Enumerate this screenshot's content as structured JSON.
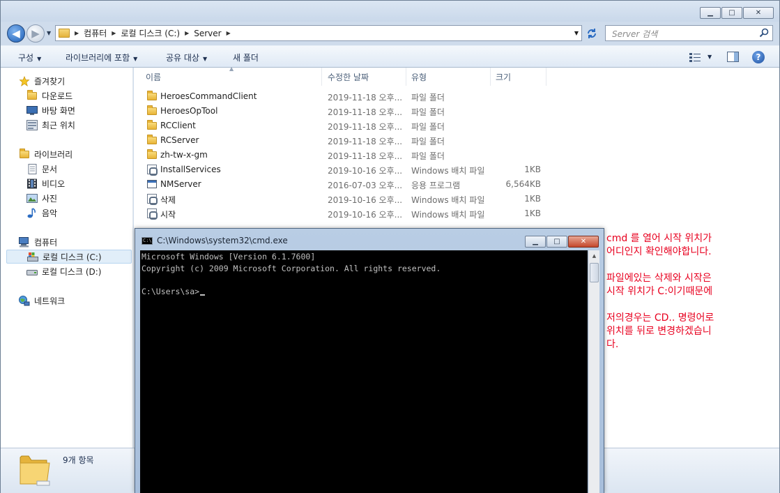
{
  "explorer": {
    "window_buttons": {
      "minimize": "▁",
      "maximize": "□",
      "close": "✕"
    },
    "nav": {
      "back": "◀",
      "forward": "▶"
    },
    "breadcrumb": [
      "컴퓨터",
      "로컬 디스크 (C:)",
      "Server"
    ],
    "search_placeholder": "Server 검색",
    "toolbar": {
      "organize": "구성",
      "include_library": "라이브러리에 포함",
      "share": "공유 대상",
      "new_folder": "새 폴더"
    },
    "sidebar": {
      "favorites": {
        "label": "즐겨찾기",
        "items": [
          "다운로드",
          "바탕 화면",
          "최근 위치"
        ]
      },
      "libraries": {
        "label": "라이브러리",
        "items": [
          "문서",
          "비디오",
          "사진",
          "음악"
        ]
      },
      "computer": {
        "label": "컴퓨터",
        "items": [
          "로컬 디스크 (C:)",
          "로컬 디스크 (D:)"
        ]
      },
      "network": {
        "label": "네트워크"
      }
    },
    "columns": {
      "name": "이름",
      "date": "수정한 날짜",
      "type": "유형",
      "size": "크기"
    },
    "files": [
      {
        "name": "HeroesCommandClient",
        "date": "2019-11-18 오후...",
        "type": "파일 폴더",
        "size": "",
        "icon": "folder"
      },
      {
        "name": "HeroesOpTool",
        "date": "2019-11-18 오후...",
        "type": "파일 폴더",
        "size": "",
        "icon": "folder"
      },
      {
        "name": "RCClient",
        "date": "2019-11-18 오후...",
        "type": "파일 폴더",
        "size": "",
        "icon": "folder"
      },
      {
        "name": "RCServer",
        "date": "2019-11-18 오후...",
        "type": "파일 폴더",
        "size": "",
        "icon": "folder"
      },
      {
        "name": "zh-tw-x-gm",
        "date": "2019-11-18 오후...",
        "type": "파일 폴더",
        "size": "",
        "icon": "folder"
      },
      {
        "name": "InstallServices",
        "date": "2019-10-16 오후...",
        "type": "Windows 배치 파일",
        "size": "1KB",
        "icon": "batch"
      },
      {
        "name": "NMServer",
        "date": "2016-07-03 오후...",
        "type": "응용 프로그램",
        "size": "6,564KB",
        "icon": "exe"
      },
      {
        "name": "삭제",
        "date": "2019-10-16 오후...",
        "type": "Windows 배치 파일",
        "size": "1KB",
        "icon": "batch"
      },
      {
        "name": "시작",
        "date": "2019-10-16 오후...",
        "type": "Windows 배치 파일",
        "size": "1KB",
        "icon": "batch"
      }
    ],
    "status": "9개 항목"
  },
  "cmd": {
    "title": "C:\\Windows\\system32\\cmd.exe",
    "icon_text": "C:\\",
    "buttons": {
      "minimize": "▁",
      "maximize": "□",
      "close": "✕"
    },
    "lines": [
      "Microsoft Windows [Version 6.1.7600]",
      "Copyright (c) 2009 Microsoft Corporation. All rights reserved.",
      "",
      "C:\\Users\\sa>"
    ]
  },
  "annotation": {
    "p1": "cmd 를 열어 시작 위치가\n어디인지 확인해야합니다.",
    "p2": "파일에있는 삭제와 시작은\n시작 위치가 C:이기때문에",
    "p3": "저의경우는 CD.. 명령어로\n위치를 뒤로 변경하겠습니\n다.",
    "color": "#e8001f"
  },
  "icons": {
    "back": "back-arrow-icon",
    "forward": "forward-arrow-icon",
    "refresh": "refresh-icon",
    "search": "search-icon",
    "help": "help-icon",
    "folder": "folder-icon",
    "batch": "batch-file-icon",
    "exe": "application-icon"
  }
}
